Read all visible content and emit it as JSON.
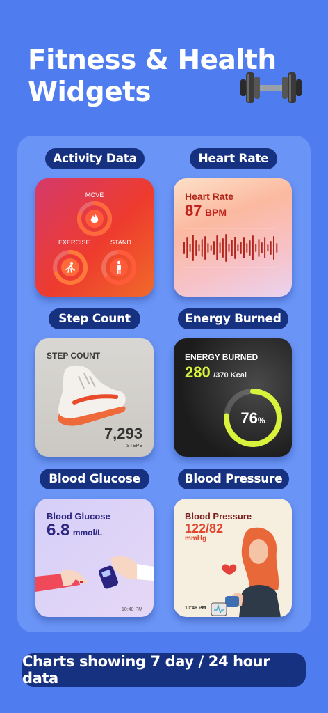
{
  "header": {
    "title_line1": "Fitness & Health",
    "title_line2": "Widgets",
    "icon": "dumbbell-icon"
  },
  "labels": {
    "activity": "Activity Data",
    "heart_rate": "Heart Rate",
    "step_count": "Step Count",
    "energy_burned": "Energy Burned",
    "blood_glucose": "Blood Glucose",
    "blood_pressure": "Blood Pressure"
  },
  "activity_widget": {
    "move": "MOVE",
    "exercise": "EXERCISE",
    "stand": "STAND",
    "colors": {
      "accent": "#e83b3b"
    }
  },
  "heart_rate_widget": {
    "title": "Heart Rate",
    "value": "87",
    "unit": "BPM"
  },
  "step_widget": {
    "title": "STEP COUNT",
    "value": "7,293",
    "unit": "STEPS"
  },
  "energy_widget": {
    "title": "ENERGY BURNED",
    "value": "280",
    "goal": "/370 Kcal",
    "percent": "76",
    "percent_sign": "%",
    "progress": 0.76
  },
  "glucose_widget": {
    "title": "Blood Glucose",
    "value": "6.8",
    "unit": "mmol/L",
    "time": "10:40 PM"
  },
  "pressure_widget": {
    "title": "Blood Pressure",
    "value": "122/82",
    "unit": "mmHg",
    "time": "10:46 PM"
  },
  "footer": {
    "text": "Charts showing 7 day / 24 hour data"
  },
  "colors": {
    "background": "#4f7df0",
    "panel": "#6a95f6",
    "pill": "#16317f"
  }
}
